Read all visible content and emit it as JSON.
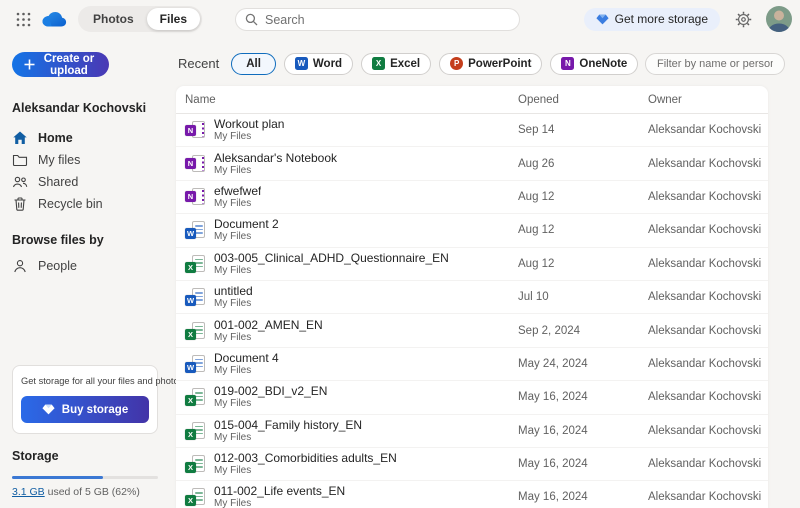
{
  "header": {
    "toggle": {
      "photos": "Photos",
      "files": "Files",
      "selected": "Files"
    },
    "search_placeholder": "Search",
    "get_more_storage_label": "Get more storage"
  },
  "sidebar": {
    "create_button_label": "Create or upload",
    "account_name": "Aleksandar Kochovski",
    "nav": [
      {
        "label": "Home",
        "selected": true
      },
      {
        "label": "My files",
        "selected": false
      },
      {
        "label": "Shared",
        "selected": false
      },
      {
        "label": "Recycle bin",
        "selected": false
      }
    ],
    "browse_header": "Browse files by",
    "browse_items": [
      {
        "label": "People"
      }
    ],
    "promo": {
      "text": "Get storage for all your files and photos.",
      "button_label": "Buy storage"
    },
    "storage": {
      "heading": "Storage",
      "used_link": "3.1 GB",
      "rest_text": " used of 5 GB (62%)",
      "percent_used": 62
    }
  },
  "filters": {
    "recent_label": "Recent",
    "pills": [
      {
        "label": "All",
        "app": null,
        "active": true
      },
      {
        "label": "Word",
        "app": "word",
        "active": false
      },
      {
        "label": "Excel",
        "app": "excel",
        "active": false
      },
      {
        "label": "PowerPoint",
        "app": "powerpoint",
        "active": false
      },
      {
        "label": "OneNote",
        "app": "onenote",
        "active": false
      }
    ],
    "filter_placeholder": "Filter by name or person"
  },
  "apps": {
    "word": {
      "letter": "W",
      "color": "#185abd"
    },
    "excel": {
      "letter": "X",
      "color": "#107c41"
    },
    "powerpoint": {
      "letter": "P",
      "color": "#c43e1c"
    },
    "onenote": {
      "letter": "N",
      "color": "#7719aa"
    }
  },
  "table": {
    "columns": {
      "name": "Name",
      "opened": "Opened",
      "owner": "Owner"
    },
    "rows": [
      {
        "name": "Workout plan",
        "location": "My Files",
        "app": "onenote",
        "opened": "Sep 14",
        "owner": "Aleksandar Kochovski"
      },
      {
        "name": "Aleksandar's Notebook",
        "location": "My Files",
        "app": "onenote",
        "opened": "Aug 26",
        "owner": "Aleksandar Kochovski"
      },
      {
        "name": "efwefwef",
        "location": "My Files",
        "app": "onenote",
        "opened": "Aug 12",
        "owner": "Aleksandar Kochovski"
      },
      {
        "name": "Document 2",
        "location": "My Files",
        "app": "word",
        "opened": "Aug 12",
        "owner": "Aleksandar Kochovski"
      },
      {
        "name": "003-005_Clinical_ADHD_Questionnaire_EN",
        "location": "My Files",
        "app": "excel",
        "opened": "Aug 12",
        "owner": "Aleksandar Kochovski"
      },
      {
        "name": "untitled",
        "location": "My Files",
        "app": "word",
        "opened": "Jul 10",
        "owner": "Aleksandar Kochovski"
      },
      {
        "name": "001-002_AMEN_EN",
        "location": "My Files",
        "app": "excel",
        "opened": "Sep 2, 2024",
        "owner": "Aleksandar Kochovski"
      },
      {
        "name": "Document 4",
        "location": "My Files",
        "app": "word",
        "opened": "May 24, 2024",
        "owner": "Aleksandar Kochovski"
      },
      {
        "name": "019-002_BDI_v2_EN",
        "location": "My Files",
        "app": "excel",
        "opened": "May 16, 2024",
        "owner": "Aleksandar Kochovski"
      },
      {
        "name": "015-004_Family history_EN",
        "location": "My Files",
        "app": "excel",
        "opened": "May 16, 2024",
        "owner": "Aleksandar Kochovski"
      },
      {
        "name": "012-003_Comorbidities adults_EN",
        "location": "My Files",
        "app": "excel",
        "opened": "May 16, 2024",
        "owner": "Aleksandar Kochovski"
      },
      {
        "name": "011-002_Life events_EN",
        "location": "My Files",
        "app": "excel",
        "opened": "May 16, 2024",
        "owner": "Aleksandar Kochovski"
      }
    ]
  },
  "colors": {
    "accent_blue": "#0f6cbd",
    "gradient_start": "#1474e6",
    "gradient_end": "#4a38b4",
    "page_background": "#f6f5f3",
    "storage_fill": "#3b78d3"
  }
}
